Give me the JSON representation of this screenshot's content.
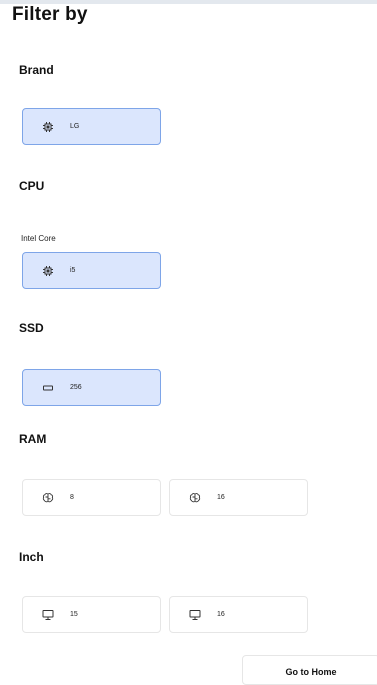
{
  "header": {
    "title": "Filter by"
  },
  "sections": {
    "brand": {
      "title": "Brand",
      "options": [
        {
          "label": "LG",
          "icon": "cpu-chip-icon",
          "selected": true
        }
      ]
    },
    "cpu": {
      "title": "CPU",
      "group_label": "Intel Core",
      "options": [
        {
          "label": "i5",
          "icon": "cpu-chip-icon",
          "selected": true
        }
      ]
    },
    "ssd": {
      "title": "SSD",
      "options": [
        {
          "label": "256",
          "icon": "storage-drive-icon",
          "selected": true
        }
      ]
    },
    "ram": {
      "title": "RAM",
      "options": [
        {
          "label": "8",
          "icon": "brain-icon",
          "selected": false
        },
        {
          "label": "16",
          "icon": "brain-icon",
          "selected": false
        }
      ]
    },
    "inch": {
      "title": "Inch",
      "options": [
        {
          "label": "15",
          "icon": "monitor-icon",
          "selected": false
        },
        {
          "label": "16",
          "icon": "monitor-icon",
          "selected": false
        }
      ]
    }
  },
  "footer": {
    "home_label": "Go to Home"
  },
  "colors": {
    "selected_bg": "#dbe6fd",
    "selected_border": "#7ea5e8",
    "border": "#e6e6e6"
  }
}
